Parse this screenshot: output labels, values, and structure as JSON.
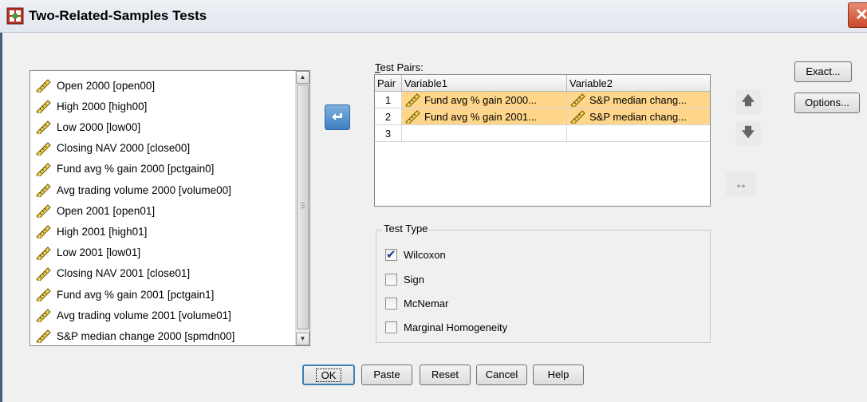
{
  "window": {
    "title": "Two-Related-Samples Tests",
    "close_glyph": "✕"
  },
  "variables": [
    "Open 2000 [open00]",
    "High 2000 [high00]",
    "Low 2000 [low00]",
    "Closing NAV 2000 [close00]",
    "Fund avg % gain 2000 [pctgain0]",
    "Avg trading volume 2000 [volume00]",
    "Open 2001 [open01]",
    "High 2001 [high01]",
    "Low 2001 [low01]",
    "Closing NAV 2001 [close01]",
    "Fund avg % gain 2001 [pctgain1]",
    "Avg trading volume 2001 [volume01]",
    "S&P median change 2000 [spmdn00]"
  ],
  "test_pairs": {
    "label": "Test Pairs:",
    "headers": {
      "pair": "Pair",
      "var1": "Variable1",
      "var2": "Variable2"
    },
    "rows": [
      {
        "num": "1",
        "var1": "Fund avg % gain 2000...",
        "var2": "S&P median chang..."
      },
      {
        "num": "2",
        "var1": "Fund avg % gain 2001...",
        "var2": "S&P median chang..."
      },
      {
        "num": "3",
        "var1": "",
        "var2": ""
      }
    ]
  },
  "test_type": {
    "legend": "Test Type",
    "options": [
      {
        "label": "Wilcoxon",
        "checked": true
      },
      {
        "label": "Sign",
        "checked": false
      },
      {
        "label": "McNemar",
        "checked": false
      },
      {
        "label": "Marginal Homogeneity",
        "checked": false
      }
    ]
  },
  "side_buttons": {
    "exact": "Exact...",
    "options": "Options..."
  },
  "bottom_buttons": {
    "ok": "OK",
    "paste": "Paste",
    "reset": "Reset",
    "cancel": "Cancel",
    "help": "Help"
  },
  "icons": {
    "scale_variable": "ruler-icon",
    "move": "arrow-left-icon",
    "up": "arrow-up-icon",
    "down": "arrow-down-icon",
    "swap": "swap-arrows-icon"
  },
  "colors": {
    "pair_fill": "#ffd68a",
    "move_button": "#3e7fc1",
    "title_bar": "#e2e7ef"
  }
}
